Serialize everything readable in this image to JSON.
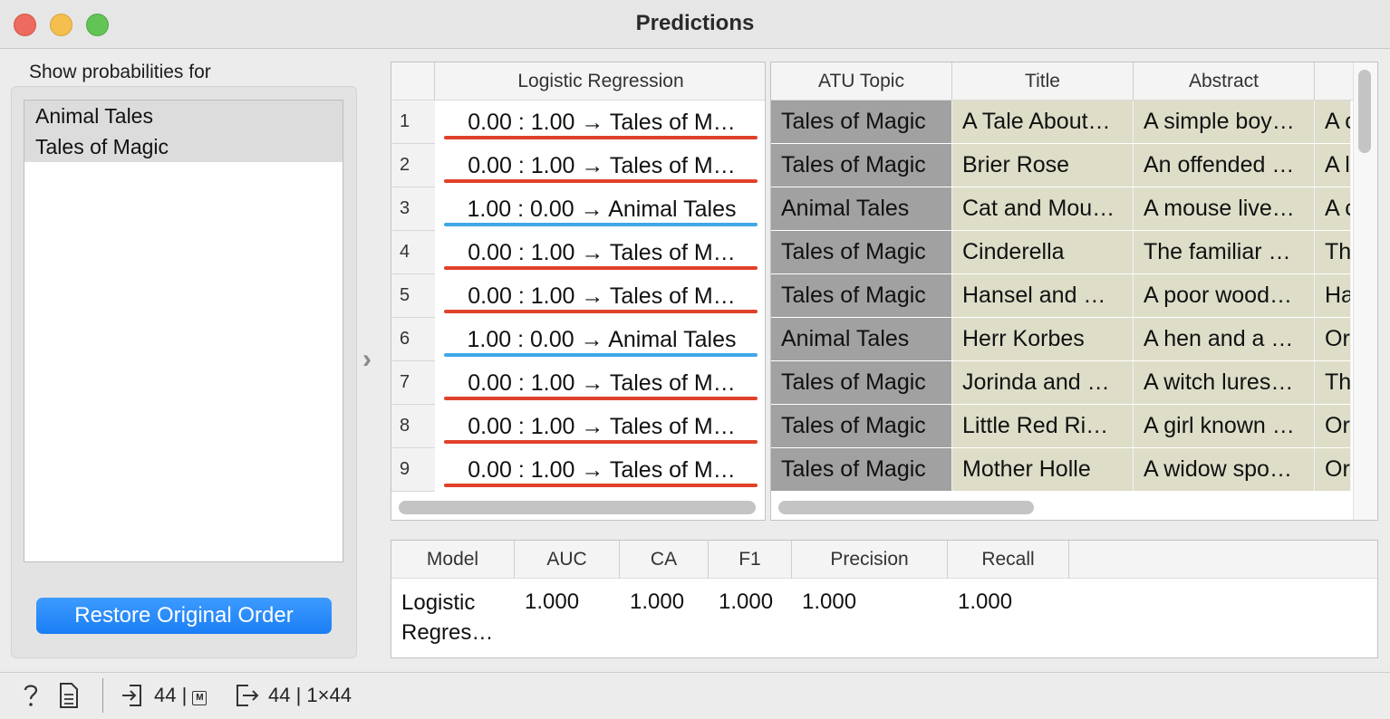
{
  "window": {
    "title": "Predictions"
  },
  "left_panel": {
    "show_label": "Show probabilities for",
    "classes": [
      "Animal Tales",
      "Tales of Magic"
    ],
    "restore_button": "Restore Original Order"
  },
  "predictions": {
    "column_header": "Logistic Regression",
    "rows": [
      {
        "num": "1",
        "value": "0.00 : 1.00 → Tales of M…",
        "class": "Tales of Magic"
      },
      {
        "num": "2",
        "value": "0.00 : 1.00 → Tales of M…",
        "class": "Tales of Magic"
      },
      {
        "num": "3",
        "value": "1.00 : 0.00 → Animal Tales",
        "class": "Animal Tales"
      },
      {
        "num": "4",
        "value": "0.00 : 1.00 → Tales of M…",
        "class": "Tales of Magic"
      },
      {
        "num": "5",
        "value": "0.00 : 1.00 → Tales of M…",
        "class": "Tales of Magic"
      },
      {
        "num": "6",
        "value": "1.00 : 0.00 → Animal Tales",
        "class": "Animal Tales"
      },
      {
        "num": "7",
        "value": "0.00 : 1.00 → Tales of M…",
        "class": "Tales of Magic"
      },
      {
        "num": "8",
        "value": "0.00 : 1.00 → Tales of M…",
        "class": "Tales of Magic"
      },
      {
        "num": "9",
        "value": "0.00 : 1.00 → Tales of M…",
        "class": "Tales of Magic"
      }
    ]
  },
  "data_table": {
    "headers": [
      "ATU Topic",
      "Title",
      "Abstract",
      ""
    ],
    "rows": [
      [
        "Tales of Magic",
        "A Tale About…",
        "A simple boy…",
        "A c"
      ],
      [
        "Tales of Magic",
        "Brier Rose",
        "An offended …",
        "A l"
      ],
      [
        "Animal Tales",
        "Cat and Mou…",
        "A mouse live…",
        "A c"
      ],
      [
        "Tales of Magic",
        "Cinderella",
        "The familiar …",
        "Th"
      ],
      [
        "Tales of Magic",
        "Hansel and …",
        "A poor wood…",
        "Ha"
      ],
      [
        "Animal Tales",
        "Herr Korbes",
        "A hen and a …",
        "Or"
      ],
      [
        "Tales of Magic",
        "Jorinda and …",
        "A witch lures…",
        "Th"
      ],
      [
        "Tales of Magic",
        "Little Red Ri…",
        "A girl known …",
        "Or"
      ],
      [
        "Tales of Magic",
        "Mother Holle",
        "A widow spo…",
        "Or"
      ]
    ]
  },
  "scores": {
    "headers": [
      "Model",
      "AUC",
      "CA",
      "F1",
      "Precision",
      "Recall"
    ],
    "rows": [
      {
        "model": "Logistic Regres…",
        "auc": "1.000",
        "ca": "1.000",
        "f1": "1.000",
        "precision": "1.000",
        "recall": "1.000"
      }
    ]
  },
  "status_bar": {
    "input_count": "44",
    "output_text": "44 | 1×44",
    "icons": [
      "help-icon",
      "report-icon",
      "input-icon",
      "output-icon"
    ]
  },
  "colors": {
    "tales_of_magic": "#e0412b",
    "animal_tales": "#3fa8e8",
    "target_bg": "#a1a1a1",
    "meta_bg": "#deddc8",
    "button_blue": "#1a7ef5"
  }
}
